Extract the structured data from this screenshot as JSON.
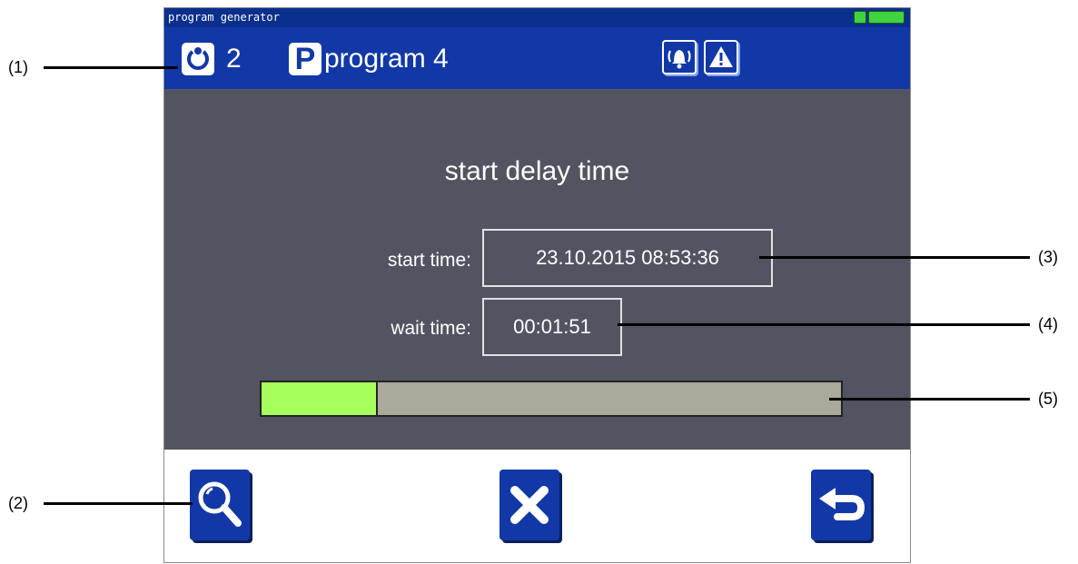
{
  "window": {
    "title": "program generator"
  },
  "header": {
    "cycle_number": "2",
    "program_name": "program 4"
  },
  "panel": {
    "heading": "start delay time",
    "start_time_label": "start time:",
    "start_time_value": "23.10.2015 08:53:36",
    "wait_time_label": "wait time:",
    "wait_time_value": "00:01:51",
    "progress_fraction": 0.2
  },
  "icons": {
    "cycle": "cycle-icon",
    "program": "program-p-icon",
    "alarm": "alarm-bell-icon",
    "warning": "warning-icon",
    "zoom": "magnifier-icon",
    "cancel": "close-icon",
    "back": "back-arrow-icon"
  },
  "colors": {
    "header": "#1238a8",
    "titlebar": "#0a2f8c",
    "panel": "#535461",
    "progress_fill": "#a7ff5c",
    "progress_track": "#a9a99c"
  },
  "callouts": [
    "(1)",
    "(2)",
    "(3)",
    "(4)",
    "(5)"
  ]
}
